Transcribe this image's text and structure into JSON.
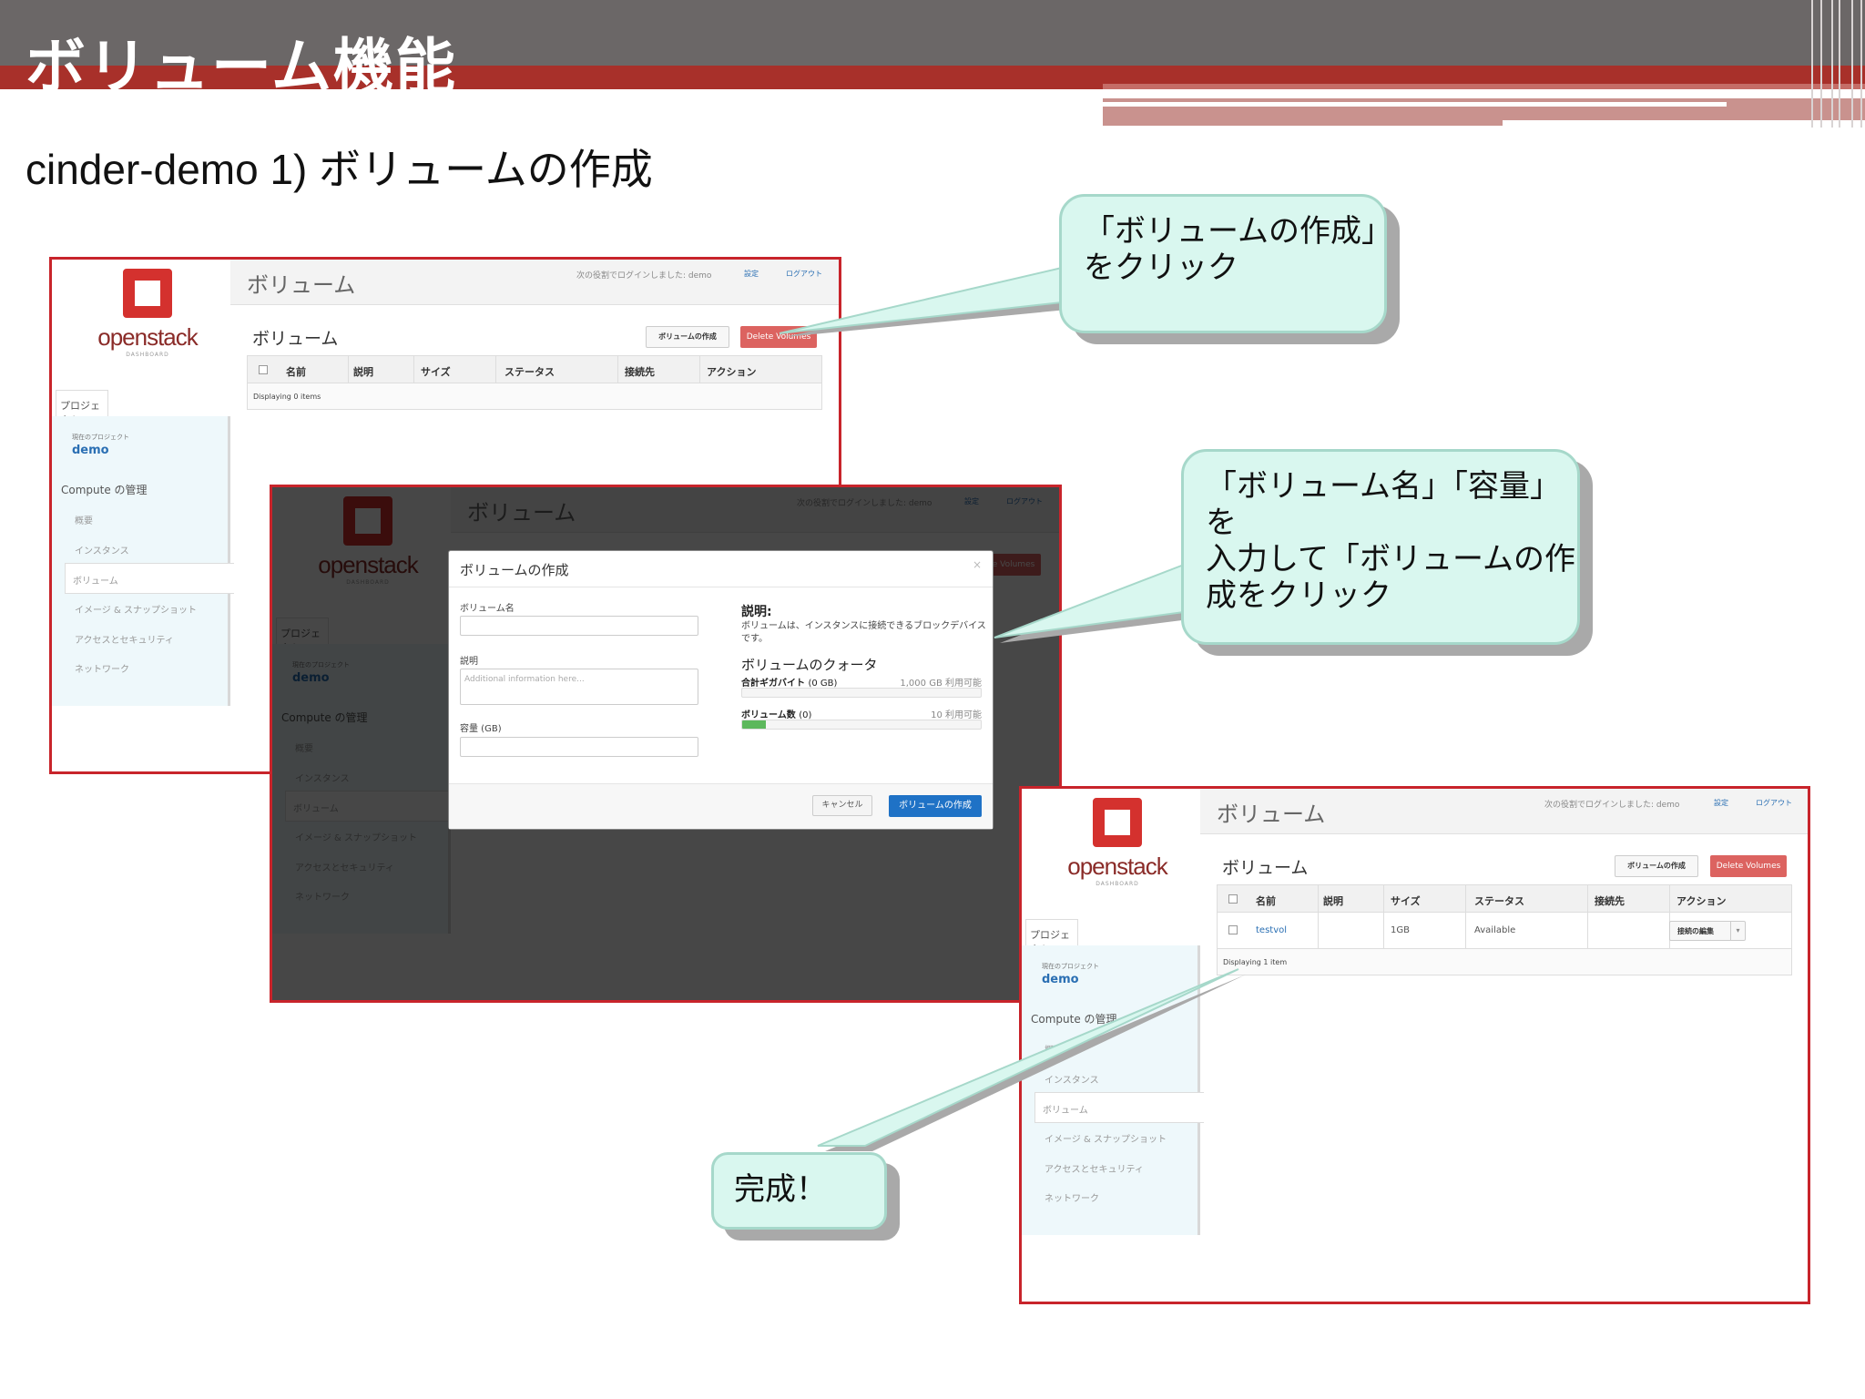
{
  "slide": {
    "title": "ボリューム機能",
    "subtitle": "cinder-demo 1) ボリュームの作成"
  },
  "dashboard": {
    "logo": "openstack",
    "logo_sub": "DASHBOARD",
    "project_tab": "プロジェクト",
    "current_project_label": "現在のプロジェクト",
    "current_project": "demo",
    "compute_header": "Compute の管理",
    "nav": [
      "概要",
      "インスタンス",
      "ボリューム",
      "イメージ & スナップショット",
      "アクセスとセキュリティ",
      "ネットワーク"
    ],
    "topbar_title": "ボリューム",
    "login_text": "次の役割でログインしました: demo",
    "settings_link": "設定",
    "logout_link": "ログアウト",
    "section_title": "ボリューム",
    "create_button": "ボリュームの作成",
    "delete_button": "Delete Volumes",
    "columns": [
      "名前",
      "説明",
      "サイズ",
      "ステータス",
      "接続先",
      "アクション"
    ]
  },
  "shot1": {
    "footer": "Displaying 0 items"
  },
  "modal": {
    "title": "ボリュームの作成",
    "close": "×",
    "name_label": "ボリューム名",
    "desc_label": "説明",
    "desc_placeholder": "Additional information here...",
    "size_label": "容量 (GB)",
    "help_title": "説明:",
    "help_text": "ボリュームは、インスタンスに接続できるブロックデバイスです。",
    "quota_title": "ボリュームのクォータ",
    "quota_gb_label": "合計ギガバイト",
    "quota_gb_used": "(0 GB)",
    "quota_gb_avail": "1,000 GB 利用可能",
    "quota_gb_fill": 0,
    "quota_vol_label": "ボリューム数",
    "quota_vol_used": "(0)",
    "quota_vol_avail": "10 利用可能",
    "quota_vol_fill": 0.1,
    "cancel": "キャンセル",
    "submit": "ボリュームの作成"
  },
  "shot3": {
    "row": {
      "name": "testvol",
      "size": "1GB",
      "status": "Available",
      "action": "接続の編集"
    },
    "footer": "Displaying 1 item"
  },
  "callouts": {
    "c1": [
      "「ボリュームの作成」",
      "をクリック"
    ],
    "c2": [
      "「ボリューム名」「容量」を",
      "入力して「ボリュームの作",
      "成をクリック"
    ],
    "c3": [
      "完成！"
    ]
  },
  "colors": {
    "accent_red": "#c8242b",
    "header_gray": "#6b6767",
    "callout_fill": "#d9f7ef",
    "primary_blue": "#1f72c6"
  }
}
